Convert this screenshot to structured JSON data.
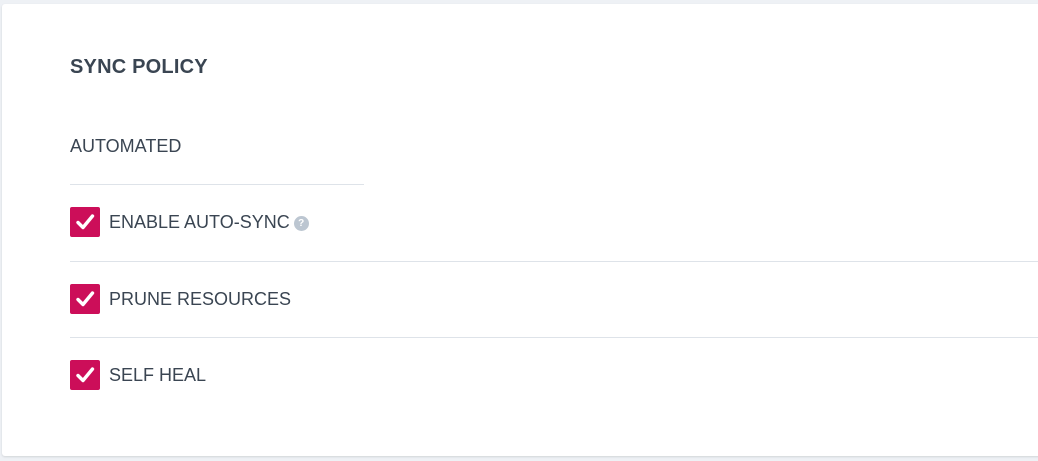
{
  "colors": {
    "accent": "#cc0e59",
    "help_icon": "#bcc6d1",
    "text": "#3a4552"
  },
  "sync_policy": {
    "title": "SYNC POLICY",
    "automated_label": "AUTOMATED",
    "options": [
      {
        "label": "ENABLE AUTO-SYNC",
        "checked": true,
        "has_help": true,
        "help_glyph": "?"
      },
      {
        "label": "PRUNE RESOURCES",
        "checked": true,
        "has_help": false
      },
      {
        "label": "SELF HEAL",
        "checked": true,
        "has_help": false
      }
    ]
  }
}
